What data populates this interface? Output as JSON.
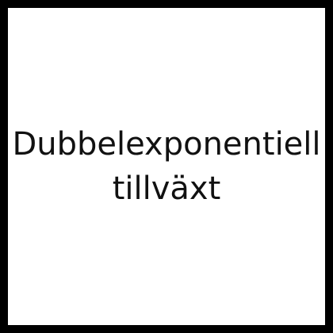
{
  "card": {
    "title_line_1": "Dubbelexponentiell",
    "title_line_2": "tillväxt",
    "background_color": "#ffffff",
    "border_color": "#000000",
    "text_color": "#111111"
  }
}
